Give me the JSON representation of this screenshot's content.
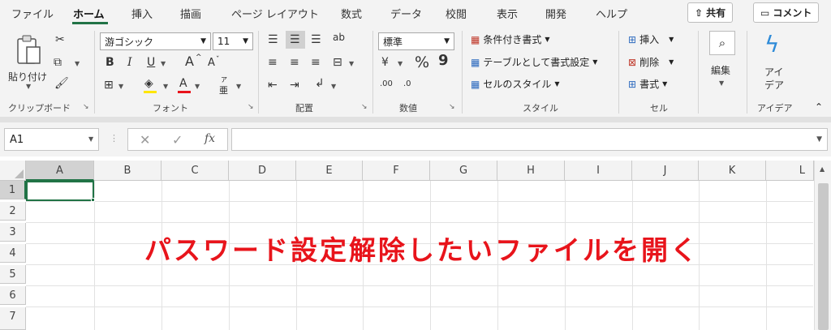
{
  "tabs": [
    "ファイル",
    "ホーム",
    "挿入",
    "描画",
    "ページ レイアウト",
    "数式",
    "データ",
    "校閲",
    "表示",
    "開発",
    "ヘルプ"
  ],
  "share_label": "共有",
  "comment_label": "コメント",
  "clipboard": {
    "paste_label": "貼り付け",
    "group_label": "クリップボード"
  },
  "font": {
    "name": "游ゴシック",
    "size": "11",
    "bold": "B",
    "italic": "I",
    "underline": "U",
    "grow": "A",
    "shrink": "A",
    "color_letter": "A",
    "phonetic_top": "ア",
    "phonetic_bottom": "亜",
    "group_label": "フォント"
  },
  "alignment": {
    "group_label": "配置"
  },
  "number": {
    "format": "標準",
    "percent": "%",
    "comma": "9",
    "inc_decimal": ".00",
    "dec_decimal": ".0",
    "group_label": "数値"
  },
  "styles": {
    "conditional": "条件付き書式",
    "as_table": "テーブルとして書式設定",
    "cell_styles": "セルのスタイル",
    "group_label": "スタイル"
  },
  "cells": {
    "insert": "挿入",
    "delete": "削除",
    "format": "書式",
    "group_label": "セル"
  },
  "editing": {
    "label": "編集"
  },
  "ideas": {
    "label_line1": "アイ",
    "label_line2": "デア",
    "group_label": "アイデア"
  },
  "formula_bar": {
    "name_box": "A1",
    "fx": "fx"
  },
  "columns": [
    "A",
    "B",
    "C",
    "D",
    "E",
    "F",
    "G",
    "H",
    "I",
    "J",
    "K",
    "L"
  ],
  "rows": [
    "1",
    "2",
    "3",
    "4",
    "5",
    "6",
    "7"
  ],
  "overlay_text": "パスワード設定解除したいファイルを開く",
  "colors": {
    "accent": "#217346",
    "overlay": "#e8141b"
  }
}
